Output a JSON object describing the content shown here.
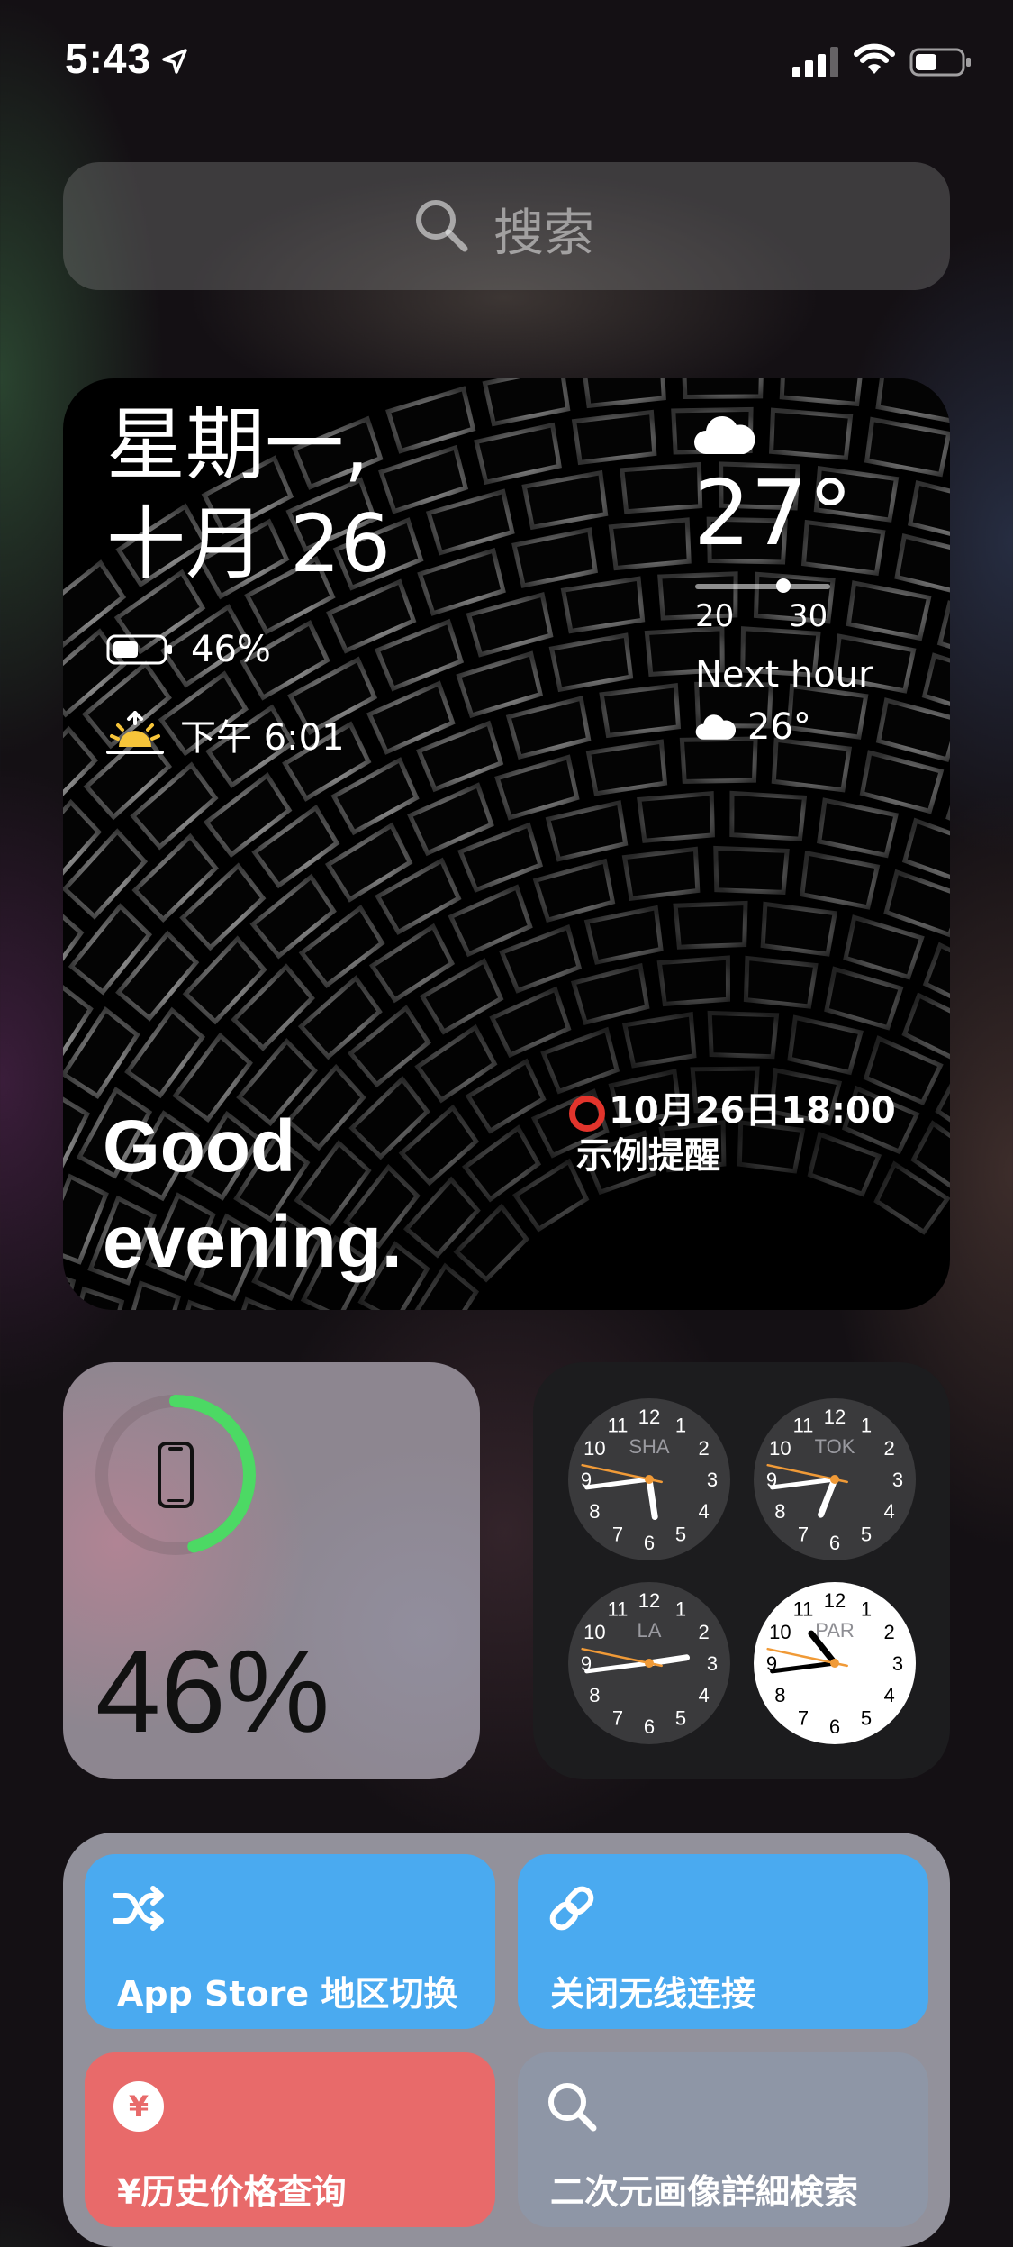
{
  "status_bar": {
    "time": "5:43"
  },
  "search": {
    "placeholder": "搜索"
  },
  "main_widget": {
    "date_line1": "星期一,",
    "date_line2": "十月 26",
    "battery_text": "46%",
    "sunset_text": "下午 6:01",
    "weather": {
      "temp": "27°",
      "low": "20",
      "high": "30",
      "next_label": "Next hour",
      "next_temp": "26°"
    },
    "greeting_line1": "Good",
    "greeting_line2": "evening.",
    "reminder_datetime": "10月26日18:00",
    "reminder_title": "示例提醒"
  },
  "battery_widget": {
    "percent_text": "46%",
    "level": 0.46,
    "ring_color": "#4cd964"
  },
  "world_clock": {
    "clocks": [
      {
        "city": "SHA",
        "hour": 5,
        "minute": 43,
        "second": 47,
        "theme": "dark"
      },
      {
        "city": "TOK",
        "hour": 6,
        "minute": 43,
        "second": 47,
        "theme": "dark"
      },
      {
        "city": "LA",
        "hour": 2,
        "minute": 43,
        "second": 47,
        "theme": "dark"
      },
      {
        "city": "PAR",
        "hour": 10,
        "minute": 43,
        "second": 47,
        "theme": "light"
      }
    ]
  },
  "shortcuts": {
    "items": [
      {
        "label": "App Store 地区切换",
        "icon": "shuffle-icon",
        "color": "#4aaaf0"
      },
      {
        "label": "关闭无线连接",
        "icon": "link-icon",
        "color": "#4aaaf0"
      },
      {
        "label": "¥历史价格查询",
        "icon": "yen-icon",
        "color": "#e86a6a"
      },
      {
        "label": "二次元画像詳細検索",
        "icon": "search-icon",
        "color": "#8e96a6"
      }
    ]
  }
}
